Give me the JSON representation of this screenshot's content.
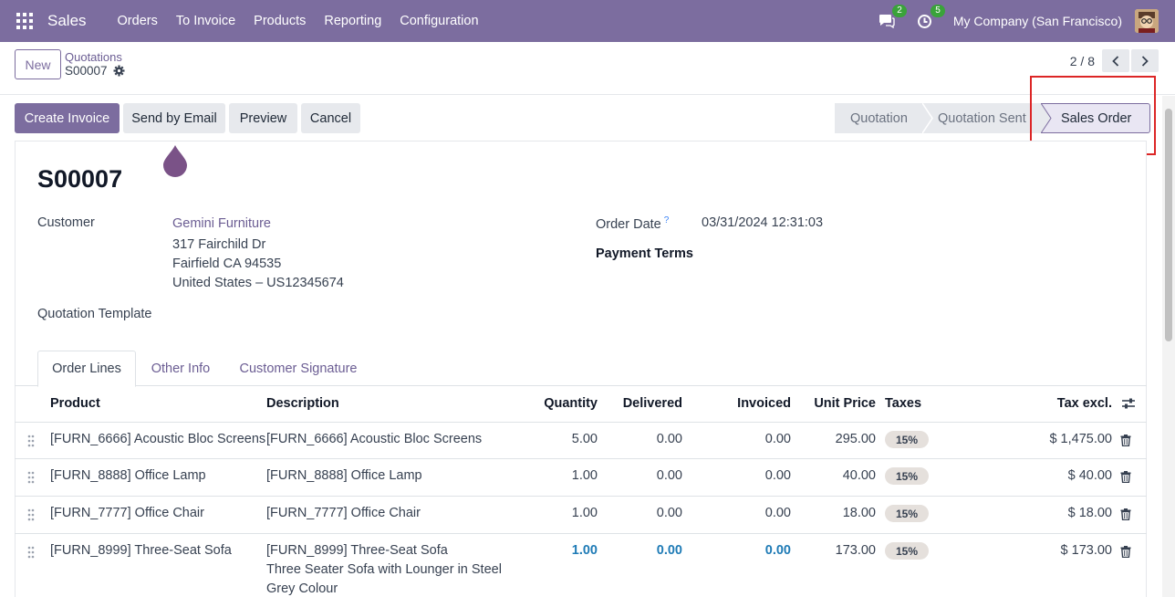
{
  "navbar": {
    "app_name": "Sales",
    "menu": [
      "Orders",
      "To Invoice",
      "Products",
      "Reporting",
      "Configuration"
    ],
    "messages_count": "2",
    "activities_count": "5",
    "company": "My Company (San Francisco)"
  },
  "control_panel": {
    "new_label": "New",
    "breadcrumb_parent": "Quotations",
    "breadcrumb_current": "S00007",
    "pager": "2 / 8"
  },
  "actions": {
    "create_invoice": "Create Invoice",
    "send_email": "Send by Email",
    "preview": "Preview",
    "cancel": "Cancel"
  },
  "statusbar": {
    "steps": [
      "Quotation",
      "Quotation Sent",
      "Sales Order"
    ],
    "active": "Sales Order"
  },
  "form": {
    "name": "S00007",
    "customer_label": "Customer",
    "customer_name": "Gemini Furniture",
    "address_line1": "317 Fairchild Dr",
    "address_line2": "Fairfield CA 94535",
    "address_line3": "United States – US12345674",
    "quotation_template_label": "Quotation Template",
    "order_date_label": "Order Date",
    "order_date_help": "?",
    "order_date": "03/31/2024 12:31:03",
    "payment_terms_label": "Payment Terms"
  },
  "tabs": [
    "Order Lines",
    "Other Info",
    "Customer Signature"
  ],
  "table": {
    "headers": {
      "product": "Product",
      "description": "Description",
      "quantity": "Quantity",
      "delivered": "Delivered",
      "invoiced": "Invoiced",
      "unit_price": "Unit Price",
      "taxes": "Taxes",
      "tax_excl": "Tax excl."
    },
    "rows": [
      {
        "product": "[FURN_6666] Acoustic Bloc Screens",
        "description": "[FURN_6666] Acoustic Bloc Screens",
        "description2": "",
        "description3": "",
        "quantity": "5.00",
        "delivered": "0.00",
        "invoiced": "0.00",
        "unit_price": "295.00",
        "tax": "15%",
        "subtotal": "$ 1,475.00"
      },
      {
        "product": "[FURN_8888] Office Lamp",
        "description": "[FURN_8888] Office Lamp",
        "description2": "",
        "description3": "",
        "quantity": "1.00",
        "delivered": "0.00",
        "invoiced": "0.00",
        "unit_price": "40.00",
        "tax": "15%",
        "subtotal": "$ 40.00"
      },
      {
        "product": "[FURN_7777] Office Chair",
        "description": "[FURN_7777] Office Chair",
        "description2": "",
        "description3": "",
        "quantity": "1.00",
        "delivered": "0.00",
        "invoiced": "0.00",
        "unit_price": "18.00",
        "tax": "15%",
        "subtotal": "$ 18.00"
      },
      {
        "product": "[FURN_8999] Three-Seat Sofa",
        "description": "[FURN_8999] Three-Seat Sofa",
        "description2": "Three Seater Sofa with Lounger in Steel",
        "description3": "Grey Colour",
        "quantity": "1.00",
        "delivered": "0.00",
        "invoiced": "0.00",
        "unit_price": "173.00",
        "tax": "15%",
        "subtotal": "$ 173.00"
      }
    ]
  },
  "colors": {
    "brand": "#7c6d9f",
    "highlight": "#dc2626",
    "badge": "#3aa33a"
  }
}
